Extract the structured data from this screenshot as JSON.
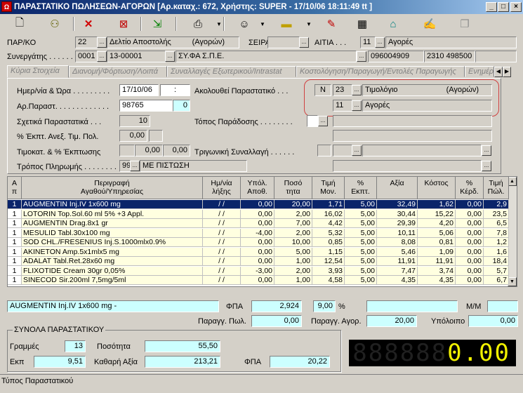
{
  "window": {
    "title": "ΠΑΡΑΣΤΑΤΙΚΟ ΠΩΛΗΣΕΩΝ-ΑΓΟΡΩΝ [Αρ.καταχ.: 672, Χρήστης: SUPER - 17/10/06 18:11:49 tt ]",
    "app_icon": "Ω"
  },
  "header": {
    "par_label": "ΠΑΡ/ΚΟ",
    "par_code": "22",
    "par_desc": "Δελτίο Αποστολής",
    "par_type": "(Αγορών)",
    "seira_label": "ΣΕΙΡΑ . .",
    "aitia_label": "ΑΙΤΙΑ . . .",
    "aitia_code": "11",
    "aitia_desc": "Αγορές",
    "syn_label": "Συνεργάτης . . . . . .",
    "syn_code": "0001",
    "syn_account": "13-00001",
    "syn_name": "ΣΥ.ΦΑ Σ.Π.Ε.",
    "syn_afm": "096004909",
    "syn_phone": "2310 498500"
  },
  "tabs": [
    "Κύρια Στοιχεία",
    "Διανομή/Φόρτωση/Λοιπά",
    "Συναλλαγές Εξωτερικού/Intrastat",
    "Κοστολόγηση/Παραγωγή/Εντολές Παραγωγής",
    "Ενημέρ"
  ],
  "main": {
    "date_label": "Ημερ/νία & Ώρα . . . . . . . . .",
    "date": "17/10/06",
    "time": ":",
    "arpar_label": "Αρ.Παραστ. . . . . . . . . . . . .",
    "arpar": "98765",
    "arpar_ext": "0",
    "sxet_label": "Σχετικά Παραστατικά . . .",
    "sxet_count": "10",
    "ekpt_label": "% Έκπτ. Ανεξ. Τιμ. Πολ.",
    "ekpt": "0,00",
    "timok_label": "Τιμοκατ. & % Έκπτωσης",
    "timok_a": "0,00",
    "timok_b": "0,00",
    "tropos_label": "Τρόπος Πληρωμής . . . . . . . .",
    "tropos_code": "99",
    "tropos_desc": "ΜΕ ΠΙΣΤΩΣΗ",
    "akol_label": "Ακολουθεί Παραστατικό . . .",
    "akol_flag": "N",
    "akol_code": "23",
    "akol_desc": "Τιμολόγιο",
    "akol_type": "(Αγορών)",
    "akol_aitia_code": "11",
    "akol_aitia_desc": "Αγορές",
    "topos_label": "Τόπος Παράδοσης . . . . . . . .",
    "trig_label": "Τριγωνική Συναλλαγή . . . . . ."
  },
  "grid": {
    "headers": [
      "Α\nπ",
      "Περιγραφή\nΑγαθού/Υπηρεσίας",
      "Ημ/νία\nλήξης",
      "Υπόλ.\nΑποθ.",
      "Ποσό\nτητα",
      "Τιμή\nΜον.",
      "%\nΕκπτ.",
      "Αξία",
      "Κόστος",
      "%\nΚέρδ.",
      "Τιμή\nΠώλ."
    ],
    "rows": [
      [
        "1",
        "AUGMENTIN Inj.IV 1x600 mg",
        "/ /",
        "0,00",
        "20,00",
        "1,71",
        "5,00",
        "32,49",
        "1,62",
        "0,00",
        "2,9"
      ],
      [
        "1",
        "LOTORIN Top.Sol.60 ml 5% +3 Appl.",
        "/ /",
        "0,00",
        "2,00",
        "16,02",
        "5,00",
        "30,44",
        "15,22",
        "0,00",
        "23,5"
      ],
      [
        "1",
        "AUGMENTIN Drag.8x1 gr",
        "/ /",
        "0,00",
        "7,00",
        "4,42",
        "5,00",
        "29,39",
        "4,20",
        "0,00",
        "6,5"
      ],
      [
        "1",
        "MESULID  Tabl.30x100 mg",
        "/ /",
        "-4,00",
        "2,00",
        "5,32",
        "5,00",
        "10,11",
        "5,06",
        "0,00",
        "7,8"
      ],
      [
        "1",
        "SOD  CHL./FRESENIUS Inj.S.1000mlx0.9%",
        "/ /",
        "0,00",
        "10,00",
        "0,85",
        "5,00",
        "8,08",
        "0,81",
        "0,00",
        "1,2"
      ],
      [
        "1",
        "AKINETON Amp.5x1mlx5 mg",
        "/ /",
        "0,00",
        "5,00",
        "1,15",
        "5,00",
        "5,46",
        "1,09",
        "0,00",
        "1,6"
      ],
      [
        "1",
        "ADALAT Tabl.Ret.28x60 mg",
        "/ /",
        "0,00",
        "1,00",
        "12,54",
        "5,00",
        "11,91",
        "11,91",
        "0,00",
        "18,4"
      ],
      [
        "1",
        "FLIXOTIDE Cream 30gr 0,05%",
        "/ /",
        "-3,00",
        "2,00",
        "3,93",
        "5,00",
        "7,47",
        "3,74",
        "0,00",
        "5,7"
      ],
      [
        "1",
        "SINECOD Sir.200ml 7,5mg/5ml",
        "/ /",
        "0,00",
        "1,00",
        "4,58",
        "5,00",
        "4,35",
        "4,35",
        "0,00",
        "6,7"
      ]
    ]
  },
  "details": {
    "item_desc": "AUGMENTIN Inj.IV 1x600 mg -",
    "fpa_label": "ΦΠΑ",
    "fpa_value": "2,924",
    "fpa_rate": "9,00",
    "percent": "%",
    "mm_label": "Μ/Μ",
    "parpol_label": "Παραγγ. Πωλ.",
    "parpol": "0,00",
    "paragor_label": "Παραγγ. Αγορ.",
    "paragor": "20,00",
    "ypol_label": "Υπόλοιπο",
    "ypol": "0,00"
  },
  "totals": {
    "title": "ΣΥΝΟΛΑ ΠΑΡΑΣΤΑΤΙΚΟΥ",
    "grammes_label": "Γραμμές",
    "grammes": "13",
    "posotita_label": "Ποσότητα",
    "posotita": "55,50",
    "ekp_label": "Εκπ",
    "ekp": "9,51",
    "kathari_label": "Καθαρή Αξία",
    "kathari": "213,21",
    "fpa_label": "ΦΠΑ",
    "fpa": "20,22",
    "display_digits": "888888",
    "display_value": "0.00"
  },
  "status": {
    "text": "Τύπος Παραστατικού"
  }
}
